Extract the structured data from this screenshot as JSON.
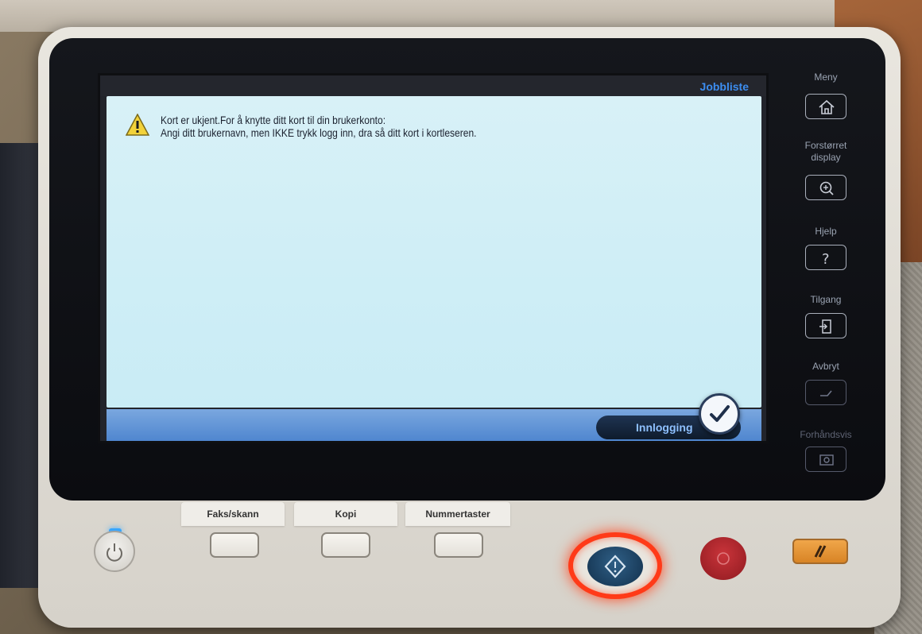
{
  "screen": {
    "top_strip": {
      "jobbliste_label": "Jobbliste"
    },
    "dialog": {
      "message_line1": "Kort er ukjent.For å knytte ditt kort til din brukerkonto:",
      "message_line2": "Angi ditt brukernavn, men IKKE trykk logg inn, dra så ditt kort i kortleseren."
    },
    "bottom_bar": {
      "login_label": "Innlogging"
    }
  },
  "side_menu": {
    "meny_label": "Meny",
    "forstorret_label": "Forstørret display",
    "hjelp_label": "Hjelp",
    "tilgang_label": "Tilgang",
    "avbryt_label": "Avbryt",
    "forhandsvis_label": "Forhåndsvis"
  },
  "hardware_tabs": {
    "faks_label": "Faks/skann",
    "kopi_label": "Kopi",
    "nummer_label": "Nummertaster"
  },
  "colors": {
    "accent_blue": "#3c8df0",
    "dialog_bg": "#d2eff6",
    "start_ring": "#ff3a18",
    "stop_red": "#b6262d",
    "reset_orange": "#e4922f"
  }
}
